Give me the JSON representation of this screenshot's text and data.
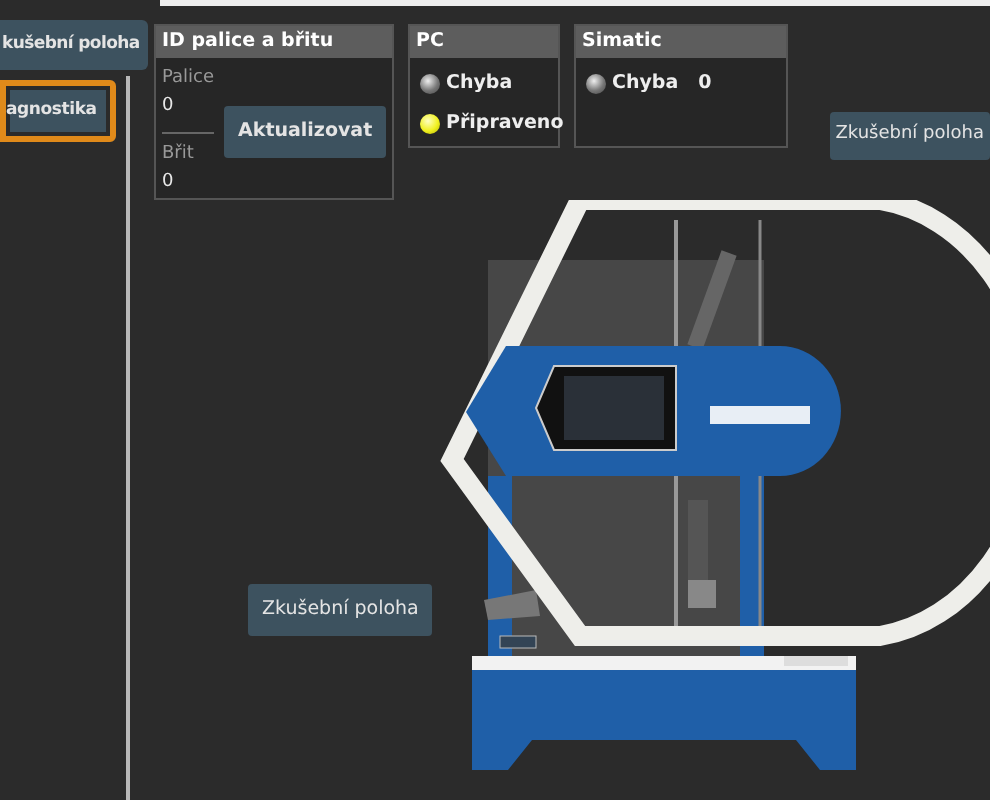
{
  "sidebar": {
    "buttons": [
      {
        "label": "kušební poloha",
        "selected": false
      },
      {
        "label": "agnostika",
        "selected": true
      }
    ]
  },
  "id_panel": {
    "title": "ID palice a břitu",
    "fields": [
      {
        "label": "Palice",
        "value": "0"
      },
      {
        "label": "Břit",
        "value": "0"
      }
    ],
    "button": "Aktualizovat"
  },
  "status_panels": [
    {
      "title": "PC",
      "indicators": [
        {
          "label": "Chyba",
          "on": false
        },
        {
          "label": "Připraveno",
          "on": true
        }
      ]
    },
    {
      "title": "Simatic",
      "indicators": [
        {
          "label": "Chyba",
          "on": false,
          "value": "0"
        }
      ]
    }
  ],
  "buttons": [
    "Zkušební poloha",
    "Zkušební poloha"
  ]
}
